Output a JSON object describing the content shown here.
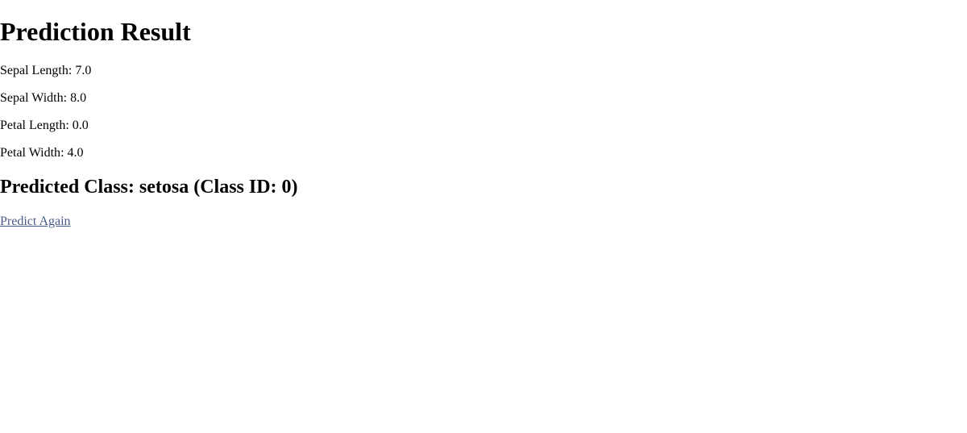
{
  "title": "Prediction Result",
  "inputs": {
    "sepal_length": {
      "label": "Sepal Length",
      "value": "7.0"
    },
    "sepal_width": {
      "label": "Sepal Width",
      "value": "8.0"
    },
    "petal_length": {
      "label": "Petal Length",
      "value": "0.0"
    },
    "petal_width": {
      "label": "Petal Width",
      "value": "4.0"
    }
  },
  "prediction": {
    "label_prefix": "Predicted Class: ",
    "class_name": "setosa",
    "class_id_prefix": " (Class ID: ",
    "class_id": "0",
    "class_id_suffix": ")"
  },
  "link": {
    "text": "Predict Again",
    "href": "#"
  }
}
